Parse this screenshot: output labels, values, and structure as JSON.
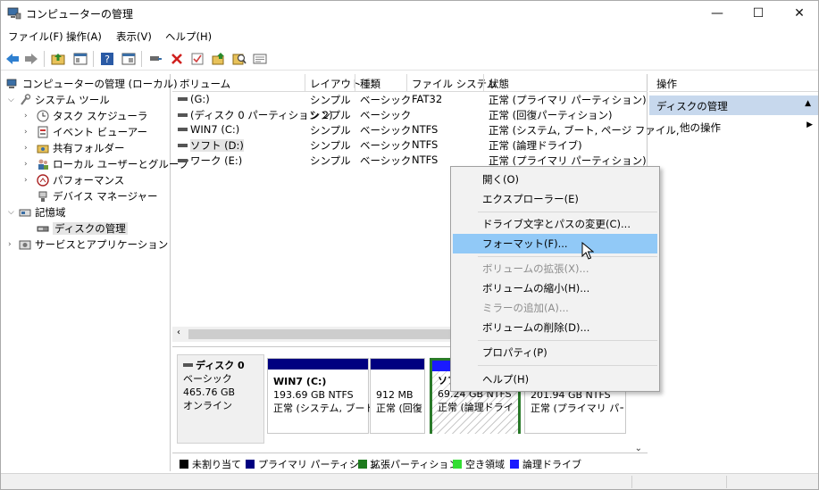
{
  "window": {
    "title": "コンピューターの管理",
    "minimize": "—",
    "maximize": "☐",
    "close": "✕"
  },
  "menu": [
    "ファイル(F)",
    "操作(A)",
    "表示(V)",
    "ヘルプ(H)"
  ],
  "toolbar_icons": [
    "back-icon",
    "forward-icon",
    "up-folder-icon",
    "show-hide-tree-icon",
    "help-icon",
    "properties-icon",
    "connect-icon",
    "delete-icon",
    "check-icon",
    "open-folder-icon",
    "search-icon",
    "details-icon"
  ],
  "tree": {
    "root": "コンピューターの管理 (ローカル)",
    "system_tools": "システム ツール",
    "task_scheduler": "タスク スケジューラ",
    "event_viewer": "イベント ビューアー",
    "shared_folders": "共有フォルダー",
    "local_users": "ローカル ユーザーとグループ",
    "performance": "パフォーマンス",
    "device_manager": "デバイス マネージャー",
    "storage": "記憶域",
    "disk_management": "ディスクの管理",
    "services": "サービスとアプリケーション"
  },
  "columns": [
    "ボリューム",
    "レイアウト",
    "種類",
    "ファイル システム",
    "状態"
  ],
  "volumes": [
    {
      "name": "(G:)",
      "layout": "シンプル",
      "type": "ベーシック",
      "fs": "FAT32",
      "status": "正常 (プライマリ パーティション)"
    },
    {
      "name": "(ディスク 0 パーティション 2)",
      "layout": "シンプル",
      "type": "ベーシック",
      "fs": "",
      "status": "正常 (回復パーティション)"
    },
    {
      "name": "WIN7 (C:)",
      "layout": "シンプル",
      "type": "ベーシック",
      "fs": "NTFS",
      "status": "正常 (システム, ブート, ページ ファイル,"
    },
    {
      "name": "ソフト (D:)",
      "layout": "シンプル",
      "type": "ベーシック",
      "fs": "NTFS",
      "status": "正常 (論理ドライブ)"
    },
    {
      "name": "ワーク (E:)",
      "layout": "シンプル",
      "type": "ベーシック",
      "fs": "NTFS",
      "status": "正常 (プライマリ パーティション)"
    }
  ],
  "disk": {
    "label": "ディスク 0",
    "type": "ベーシック",
    "size": "465.76 GB",
    "state": "オンライン"
  },
  "partitions": [
    {
      "name": "WIN7 (C:)",
      "size": "193.69 GB NTFS",
      "status": "正常 (システム, ブート,"
    },
    {
      "name": "",
      "size": "912 MB",
      "status": "正常 (回復"
    },
    {
      "name": "ソフ",
      "size": "69.24 GB NTFS",
      "status": "正常 (論理ドライ"
    },
    {
      "name": "",
      "size": "201.94 GB NTFS",
      "status": "正常 (プライマリ パーテ"
    }
  ],
  "legend": [
    {
      "label": "未割り当て",
      "color": "#000000"
    },
    {
      "label": "プライマリ パーティション",
      "color": "#000080"
    },
    {
      "label": "拡張パーティション",
      "color": "#1e7b1e"
    },
    {
      "label": "空き領域",
      "color": "#33dd33"
    },
    {
      "label": "論理ドライブ",
      "color": "#1a1aff"
    }
  ],
  "actions": {
    "title": "操作",
    "section": "ディスクの管理",
    "more": "他の操作"
  },
  "context_menu": {
    "open": "開く(O)",
    "explore": "エクスプローラー(E)",
    "change_letter": "ドライブ文字とパスの変更(C)...",
    "format": "フォーマット(F)...",
    "extend": "ボリュームの拡張(X)...",
    "shrink": "ボリュームの縮小(H)...",
    "add_mirror": "ミラーの追加(A)...",
    "delete": "ボリュームの削除(D)...",
    "properties": "プロパティ(P)",
    "help": "ヘルプ(H)"
  }
}
